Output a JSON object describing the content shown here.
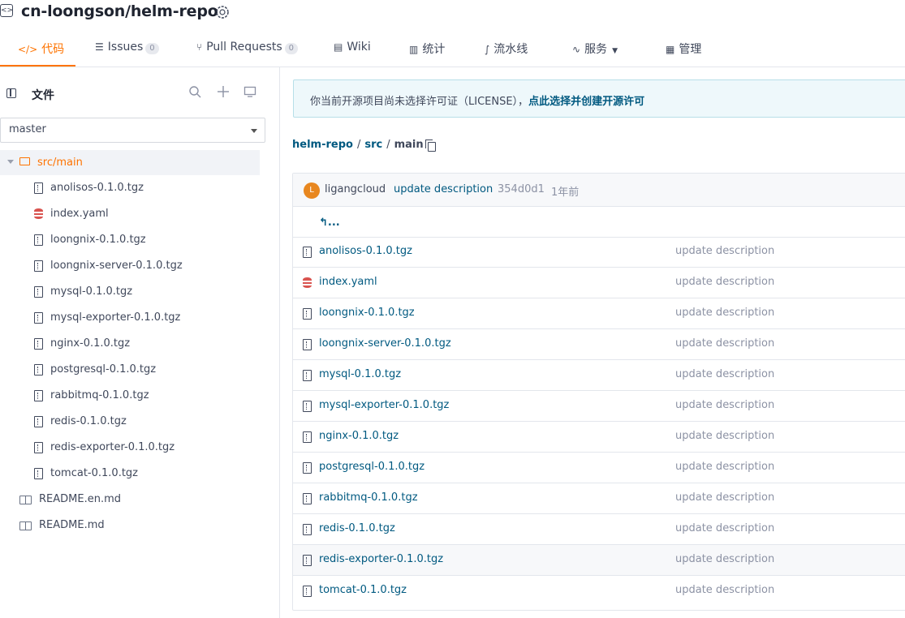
{
  "repo": {
    "title": "cn-loongson/helm-repo"
  },
  "tabs": [
    {
      "label": "代码",
      "icon": "code-icon"
    },
    {
      "label": "Issues",
      "count": "0",
      "icon": "issues-icon"
    },
    {
      "label": "Pull Requests",
      "count": "0",
      "icon": "pull-request-icon"
    },
    {
      "label": "Wiki",
      "icon": "book-icon"
    },
    {
      "label": "统计",
      "icon": "chart-icon"
    },
    {
      "label": "流水线",
      "icon": "pipeline-icon"
    },
    {
      "label": "服务",
      "icon": "pulse-icon"
    },
    {
      "label": "管理",
      "icon": "settings-doc-icon"
    }
  ],
  "sidebar": {
    "title": "文件",
    "branch": "master",
    "folder": "src/main",
    "files": [
      {
        "name": "anolisos-0.1.0.tgz",
        "type": "archive"
      },
      {
        "name": "index.yaml",
        "type": "yaml"
      },
      {
        "name": "loongnix-0.1.0.tgz",
        "type": "archive"
      },
      {
        "name": "loongnix-server-0.1.0.tgz",
        "type": "archive"
      },
      {
        "name": "mysql-0.1.0.tgz",
        "type": "archive"
      },
      {
        "name": "mysql-exporter-0.1.0.tgz",
        "type": "archive"
      },
      {
        "name": "nginx-0.1.0.tgz",
        "type": "archive"
      },
      {
        "name": "postgresql-0.1.0.tgz",
        "type": "archive"
      },
      {
        "name": "rabbitmq-0.1.0.tgz",
        "type": "archive"
      },
      {
        "name": "redis-0.1.0.tgz",
        "type": "archive"
      },
      {
        "name": "redis-exporter-0.1.0.tgz",
        "type": "archive"
      },
      {
        "name": "tomcat-0.1.0.tgz",
        "type": "archive"
      }
    ],
    "root_files": [
      {
        "name": "README.en.md"
      },
      {
        "name": "README.md"
      }
    ]
  },
  "notice": {
    "text": "你当前开源项目尚未选择许可证（LICENSE），",
    "link": "点此选择并创建开源许可"
  },
  "breadcrumb": {
    "repo": "helm-repo",
    "dir": "src",
    "current": "main",
    "sep": "/"
  },
  "commit": {
    "avatar_letter": "L",
    "author": "ligangcloud",
    "message": "update description",
    "sha": "354d0d1",
    "time": "1年前"
  },
  "parent_dir": "...",
  "table_rows": [
    {
      "name": "anolisos-0.1.0.tgz",
      "type": "archive",
      "message": "update description"
    },
    {
      "name": "index.yaml",
      "type": "yaml",
      "message": "update description"
    },
    {
      "name": "loongnix-0.1.0.tgz",
      "type": "archive",
      "message": "update description"
    },
    {
      "name": "loongnix-server-0.1.0.tgz",
      "type": "archive",
      "message": "update description"
    },
    {
      "name": "mysql-0.1.0.tgz",
      "type": "archive",
      "message": "update description"
    },
    {
      "name": "mysql-exporter-0.1.0.tgz",
      "type": "archive",
      "message": "update description"
    },
    {
      "name": "nginx-0.1.0.tgz",
      "type": "archive",
      "message": "update description"
    },
    {
      "name": "postgresql-0.1.0.tgz",
      "type": "archive",
      "message": "update description"
    },
    {
      "name": "rabbitmq-0.1.0.tgz",
      "type": "archive",
      "message": "update description"
    },
    {
      "name": "redis-0.1.0.tgz",
      "type": "archive",
      "message": "update description"
    },
    {
      "name": "redis-exporter-0.1.0.tgz",
      "type": "archive",
      "message": "update description",
      "highlighted": true
    },
    {
      "name": "tomcat-0.1.0.tgz",
      "type": "archive",
      "message": "update description"
    }
  ],
  "colors": {
    "accent": "#fe7300",
    "link": "#005980",
    "muted": "#8c92a4"
  }
}
